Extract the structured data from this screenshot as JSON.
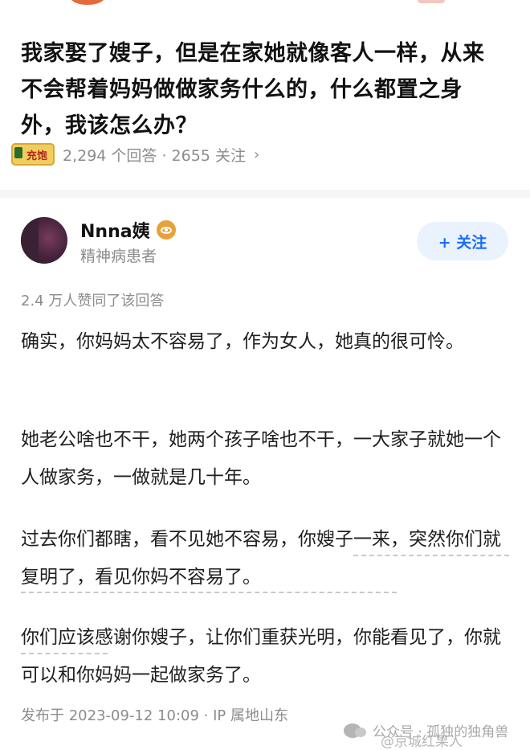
{
  "question": {
    "title": "我家娶了嫂子，但是在家她就像客人一样，从来不会帮着妈妈做做家务什么的，什么都置之身外，我该怎么办？",
    "badge_text": "充饱",
    "meta_text": "2,294 个回答 · 2655 关注",
    "chevron": "›"
  },
  "answer": {
    "author_name": "Nnna姨",
    "author_bio": "精神病患者",
    "follow_label": "+ 关注",
    "votes_text": "2.4 万人赞同了该回答",
    "paragraphs": [
      "确实，你妈妈太不容易了，作为女人，她真的很可怜。",
      "她老公啥也不干，她两个孩子啥也不干，一大家子就她一个人做家务，一做就是几十年。",
      "过去你们都瞎，看不见她不容易，你嫂子一来，突然你们就复明了，看见你妈不容易了。",
      "你们应该感谢你嫂子，让你们重获光明，你能看见了，你就可以和你妈妈一起做家务了。"
    ],
    "footer_text": "发布于 2023-09-12 10:09 · IP 属地山东"
  },
  "watermark": {
    "main": "公众号 · 孤独的独角兽",
    "sub": "@京城红果人"
  },
  "colors": {
    "accent": "#1d6df2",
    "follow_bg": "#eaf2fe",
    "meta_gray": "#8c8c8c",
    "badge_gold": "#e8a23a"
  }
}
